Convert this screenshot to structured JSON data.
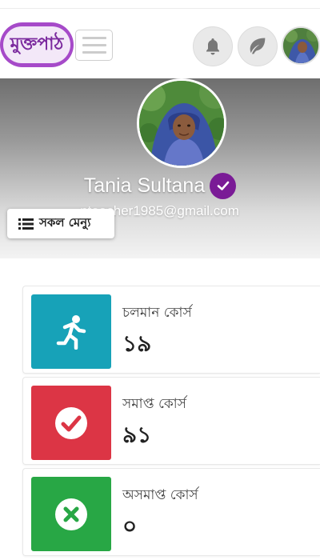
{
  "header": {
    "logo_text": "মুক্তপাঠ",
    "colors": {
      "logo": "#a64ac9"
    },
    "icons": [
      "hamburger-menu-icon",
      "bell-icon",
      "leaf-icon",
      "user-avatar"
    ]
  },
  "profile": {
    "name": "Tania Sultana",
    "email": "...nteacher1985@gmail.com",
    "verified_color": "#7a1b96"
  },
  "menu_button": {
    "label": "সকল মেন্যু",
    "icon": "list-icon"
  },
  "stats": [
    {
      "title": "চলমান কোর্স",
      "value": "১৯",
      "icon": "running-person-icon",
      "color": "#17a2b8"
    },
    {
      "title": "সমাপ্ত কোর্স",
      "value": "৯১",
      "icon": "check-circle-icon",
      "color": "#dc3545"
    },
    {
      "title": "অসমাপ্ত কোর্স",
      "value": "০",
      "icon": "times-circle-icon",
      "color": "#28a745"
    }
  ]
}
